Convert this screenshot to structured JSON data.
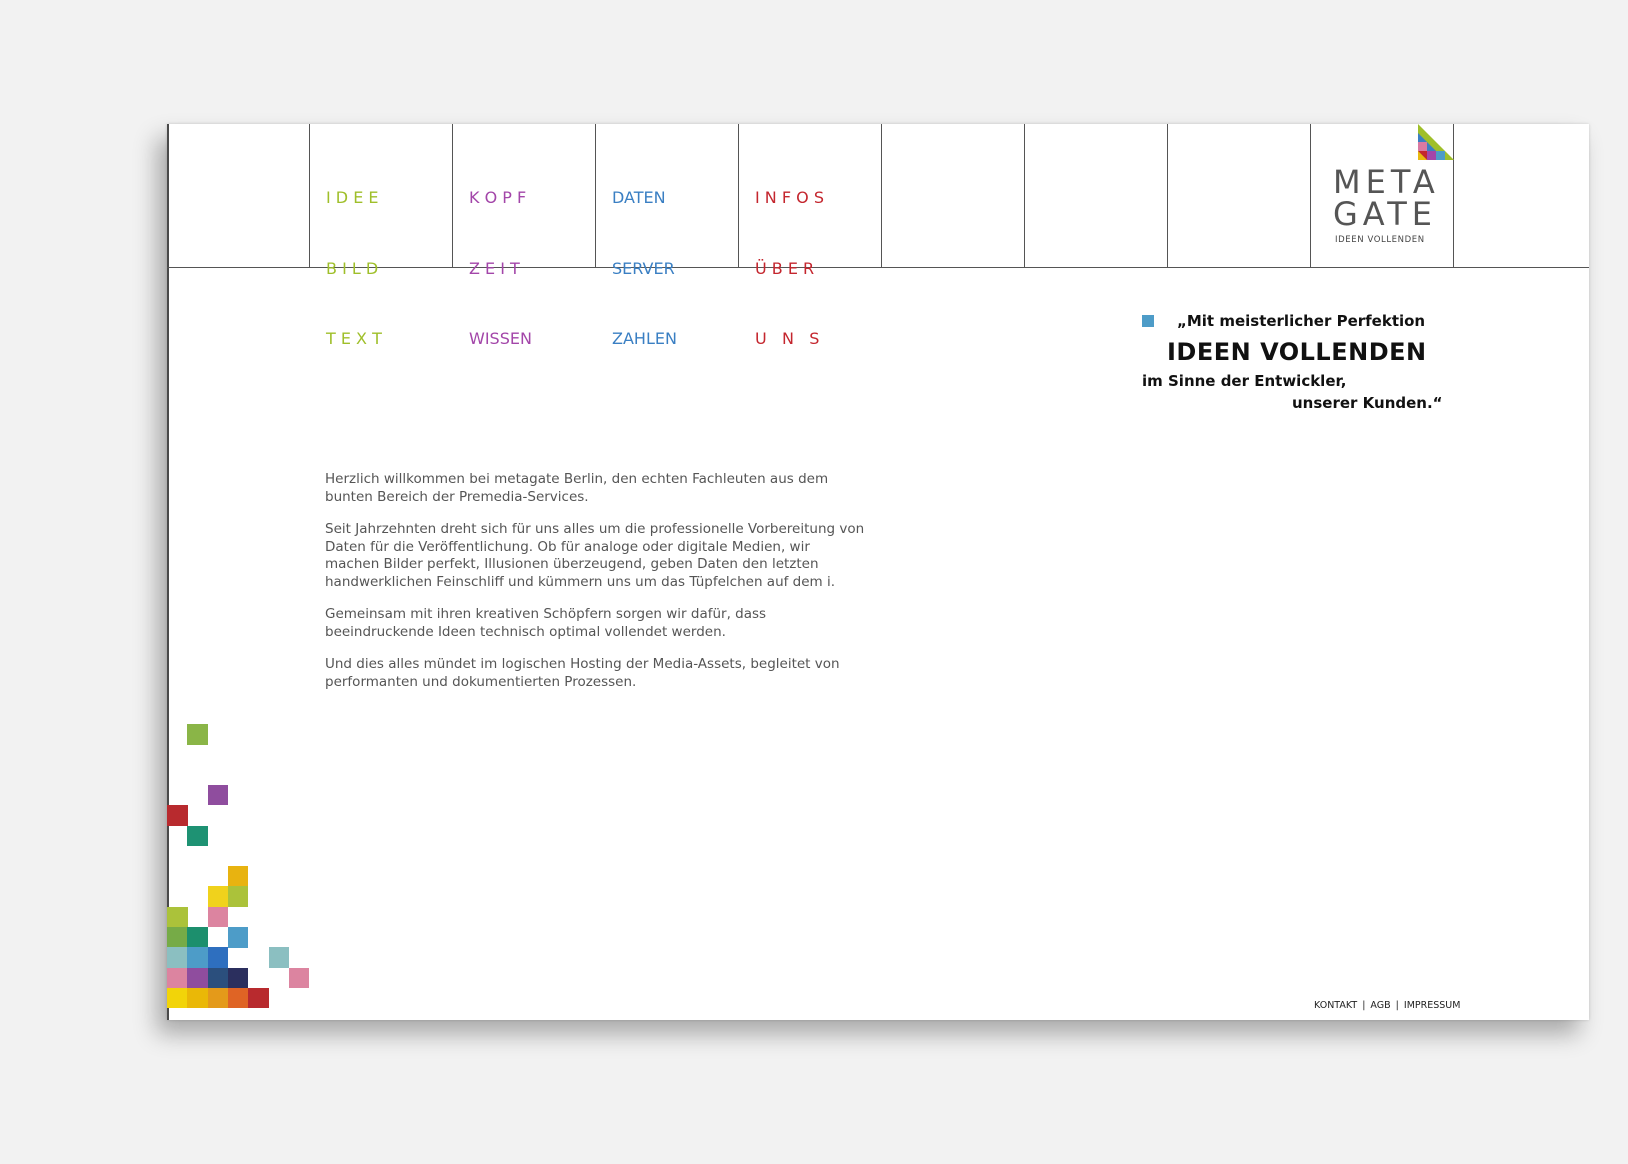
{
  "nav": {
    "columns": [
      {
        "lines": [
          "I D E E",
          "B I L D",
          "T E X T"
        ],
        "color": "#9fbf2a"
      },
      {
        "lines": [
          "K O P F",
          "Z E I T",
          "WISSEN"
        ],
        "color": "#a346a9"
      },
      {
        "lines": [
          "DATEN",
          "SERVER",
          "ZAHLEN"
        ],
        "color": "#3a7fc3"
      },
      {
        "lines": [
          "I N F O S",
          "Ü B E R",
          "U   N   S"
        ],
        "color": "#c4262e"
      }
    ]
  },
  "logo": {
    "word_line1": "META",
    "word_line2": "GATE",
    "tagline": "IDEEN VOLLENDEN"
  },
  "quote": {
    "line1": "„Mit meisterlicher Perfektion",
    "line2": "IDEEN VOLLENDEN",
    "line3": "im Sinne der Entwickler,",
    "line4": "unserer Kunden.“",
    "bullet_color": "#4d9cc8"
  },
  "intro": {
    "paragraphs": [
      "Herzlich willkommen bei metagate Berlin, den echten Fachleuten aus dem bunten Bereich der Premedia-Services.",
      "Seit Jahrzehnten dreht sich für uns alles um die professionelle Vorbereitung von Daten für die Veröffentlichung. Ob für analoge oder digitale Medien, wir machen Bilder perfekt, Illusionen überzeugend, geben Daten den letzten handwerklichen Feinschliff und kümmern uns um das Tüpfelchen auf dem i.",
      "Gemeinsam mit ihren kreativen Schöpfern sorgen wir dafür, dass beeindruckende Ideen technisch optimal vollendet werden.",
      "Und dies alles mündet im logischen Hosting der Media-Assets, begleitet von performanten und dokumentierten Prozessen."
    ]
  },
  "footer": {
    "kontakt": "KONTAKT",
    "agb": "AGB",
    "impressum": "IMPRESSUM",
    "separator": "|"
  },
  "colors": {
    "green": "#9fbf2a",
    "purple": "#a346a9",
    "blue": "#3a7fc3",
    "red": "#c4262e"
  }
}
